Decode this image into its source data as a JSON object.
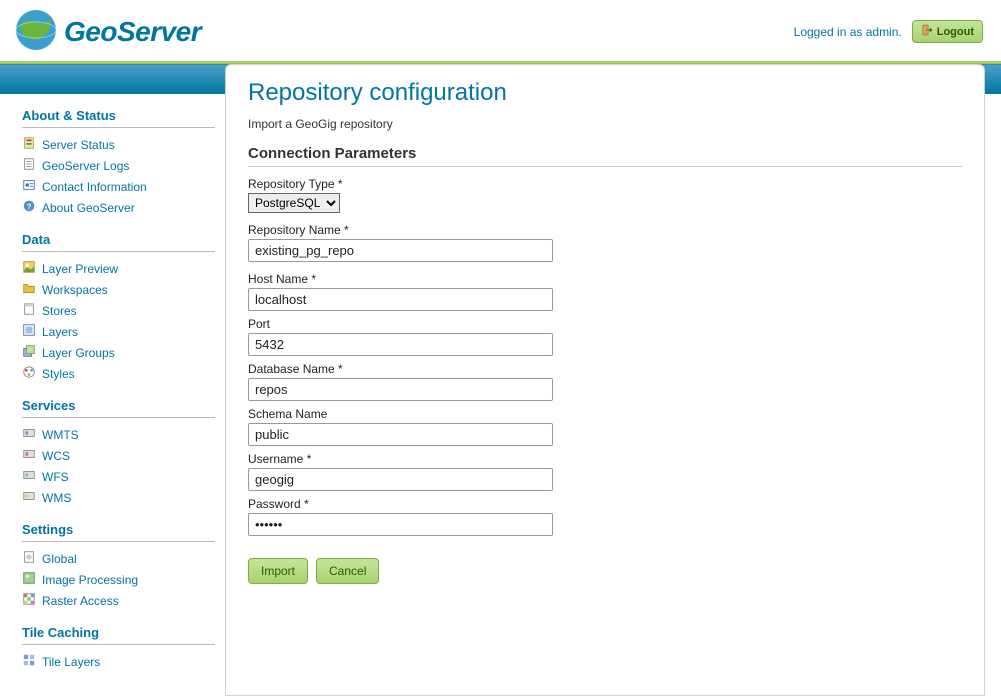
{
  "header": {
    "brand": "GeoServer",
    "logged_in": "Logged in as admin.",
    "logout": "Logout"
  },
  "sidebar": {
    "sections": [
      {
        "title": "About & Status",
        "items": [
          {
            "label": "Server Status",
            "icon": "status"
          },
          {
            "label": "GeoServer Logs",
            "icon": "log"
          },
          {
            "label": "Contact Information",
            "icon": "contact"
          },
          {
            "label": "About GeoServer",
            "icon": "about"
          }
        ]
      },
      {
        "title": "Data",
        "items": [
          {
            "label": "Layer Preview",
            "icon": "preview"
          },
          {
            "label": "Workspaces",
            "icon": "folder"
          },
          {
            "label": "Stores",
            "icon": "store"
          },
          {
            "label": "Layers",
            "icon": "layer"
          },
          {
            "label": "Layer Groups",
            "icon": "layergroup"
          },
          {
            "label": "Styles",
            "icon": "style"
          }
        ]
      },
      {
        "title": "Services",
        "items": [
          {
            "label": "WMTS",
            "icon": "svc"
          },
          {
            "label": "WCS",
            "icon": "svc"
          },
          {
            "label": "WFS",
            "icon": "svc"
          },
          {
            "label": "WMS",
            "icon": "svc"
          }
        ]
      },
      {
        "title": "Settings",
        "items": [
          {
            "label": "Global",
            "icon": "global"
          },
          {
            "label": "Image Processing",
            "icon": "image"
          },
          {
            "label": "Raster Access",
            "icon": "raster"
          }
        ]
      },
      {
        "title": "Tile Caching",
        "items": [
          {
            "label": "Tile Layers",
            "icon": "tile"
          }
        ]
      }
    ]
  },
  "page": {
    "title": "Repository configuration",
    "desc": "Import a GeoGig repository",
    "section": "Connection Parameters",
    "fields": {
      "repo_type_label": "Repository Type *",
      "repo_type_value": "PostgreSQL",
      "repo_name_label": "Repository Name *",
      "repo_name_value": "existing_pg_repo",
      "host_label": "Host Name *",
      "host_value": "localhost",
      "port_label": "Port",
      "port_value": "5432",
      "db_label": "Database Name *",
      "db_value": "repos",
      "schema_label": "Schema Name",
      "schema_value": "public",
      "user_label": "Username *",
      "user_value": "geogig",
      "pass_label": "Password *",
      "pass_value": "geogig"
    },
    "actions": {
      "import": "Import",
      "cancel": "Cancel"
    }
  }
}
